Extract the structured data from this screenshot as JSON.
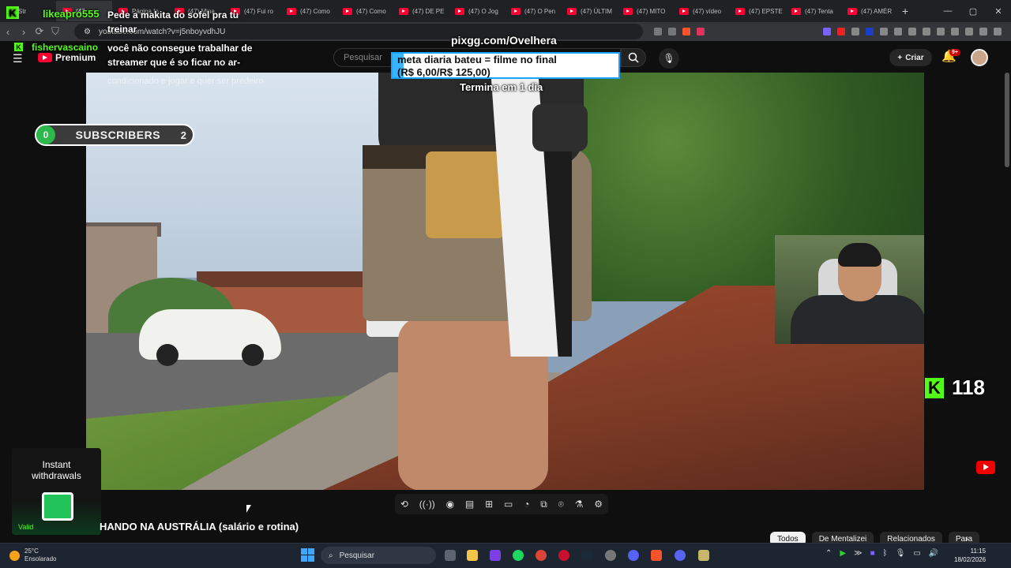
{
  "browser": {
    "tabs": [
      {
        "label": "Str",
        "icon": "kick-icon",
        "active": false
      },
      {
        "label": "(47",
        "icon": "youtube-icon",
        "active": true
      },
      {
        "label": "Página In",
        "icon": "youtube-icon",
        "active": false
      },
      {
        "label": "(47) Mina",
        "icon": "youtube-icon",
        "active": false
      },
      {
        "label": "(47) Fui ro",
        "icon": "youtube-icon",
        "active": false
      },
      {
        "label": "(47) Como",
        "icon": "youtube-icon",
        "active": false
      },
      {
        "label": "(47) Como",
        "icon": "youtube-icon",
        "active": false
      },
      {
        "label": "(47) DE PE",
        "icon": "youtube-icon",
        "active": false
      },
      {
        "label": "(47) O Jog",
        "icon": "youtube-icon",
        "active": false
      },
      {
        "label": "(47) O Pen",
        "icon": "youtube-icon",
        "active": false
      },
      {
        "label": "(47) ÚLTIM",
        "icon": "youtube-icon",
        "active": false
      },
      {
        "label": "(47) MITO",
        "icon": "youtube-icon",
        "active": false
      },
      {
        "label": "(47) vídeo",
        "icon": "youtube-icon",
        "active": false
      },
      {
        "label": "(47) EPSTE",
        "icon": "youtube-icon",
        "active": false
      },
      {
        "label": "(47) Tenta",
        "icon": "youtube-icon",
        "active": false
      },
      {
        "label": "(47) AMÉR",
        "icon": "youtube-icon",
        "active": false
      }
    ],
    "url": "youtube.com/watch?v=j5nboyvdhJU"
  },
  "youtube": {
    "premium_label": "Premium",
    "search_placeholder": "Pesquisar",
    "create_label": "Criar",
    "notifications": "9+",
    "video_title": "HANDO NA AUSTRÁLIA (salário e rotina)",
    "chips": [
      "Todos",
      "De Mentalizei",
      "Relacionados",
      "Para"
    ]
  },
  "overlay": {
    "chat": [
      {
        "user": "likeapro555",
        "message": "Pede a makita do sofel pra tu treinar"
      },
      {
        "user": "fishervascaino",
        "message": "você não consegue trabalhar de streamer que é so ficar no ar-",
        "faded": "condicionado e jogar e quer ser predeiro"
      }
    ],
    "pix_link": "pixgg.com/Ovelhera",
    "goal": {
      "text": "meta diaria bateu = filme no final",
      "amount": "(R$ 6,00/R$ 125,00)",
      "progress": 0.048
    },
    "ends": "Termina em 1 dia",
    "subscribers": {
      "current": "0",
      "label": "SUBSCRIBERS",
      "goal": "2"
    },
    "viewers": "118",
    "ad": {
      "line1": "Instant",
      "line2": "withdrawals",
      "badge": "Valid"
    }
  },
  "taskbar": {
    "weather_temp": "25°C",
    "weather_desc": "Ensolarado",
    "search_label": "Pesquisar",
    "time": "11:15",
    "date": "18/02/2026"
  },
  "colors": {
    "kick": "#53fc18",
    "youtube_red": "#ff0033",
    "goal_border": "#18a4ff"
  }
}
